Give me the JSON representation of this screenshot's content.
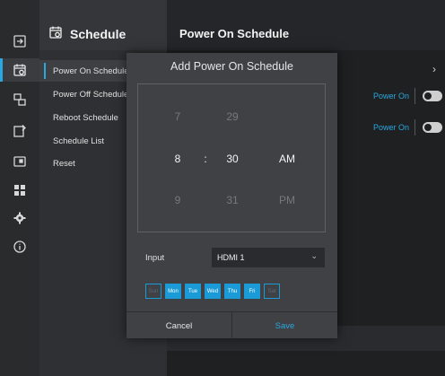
{
  "menu": {
    "title": "Schedule",
    "items": [
      {
        "label": "Power On Schedule"
      },
      {
        "label": "Power Off Schedule"
      },
      {
        "label": "Reboot Schedule"
      },
      {
        "label": "Schedule List"
      },
      {
        "label": "Reset"
      }
    ]
  },
  "rail": {
    "icons": [
      "input-icon",
      "schedule-icon",
      "network-icon",
      "protect-icon",
      "display-icon",
      "apps-icon",
      "settings-icon",
      "info-icon"
    ],
    "active_index": 1
  },
  "content": {
    "title": "Power On Schedule",
    "rows": [
      {
        "label": "Power On",
        "enabled": false
      },
      {
        "label": "Power On",
        "enabled": false
      }
    ]
  },
  "dialog": {
    "title": "Add Power On Schedule",
    "picker": {
      "hour": {
        "prev": "7",
        "current": "8",
        "next": "9"
      },
      "separator": ":",
      "minute": {
        "prev": "29",
        "current": "30",
        "next": "31"
      },
      "period": {
        "current": "AM",
        "next": "PM"
      }
    },
    "input_label": "Input",
    "input_value": "HDMI 1",
    "days": [
      {
        "label": "Sun",
        "selected": false
      },
      {
        "label": "Mon",
        "selected": true
      },
      {
        "label": "Tue",
        "selected": true
      },
      {
        "label": "Wed",
        "selected": true
      },
      {
        "label": "Thu",
        "selected": true
      },
      {
        "label": "Fri",
        "selected": true
      },
      {
        "label": "Sat",
        "selected": false
      }
    ],
    "cancel_label": "Cancel",
    "save_label": "Save"
  },
  "colors": {
    "accent": "#2aa7df",
    "day_selected": "#1a9ad6"
  }
}
